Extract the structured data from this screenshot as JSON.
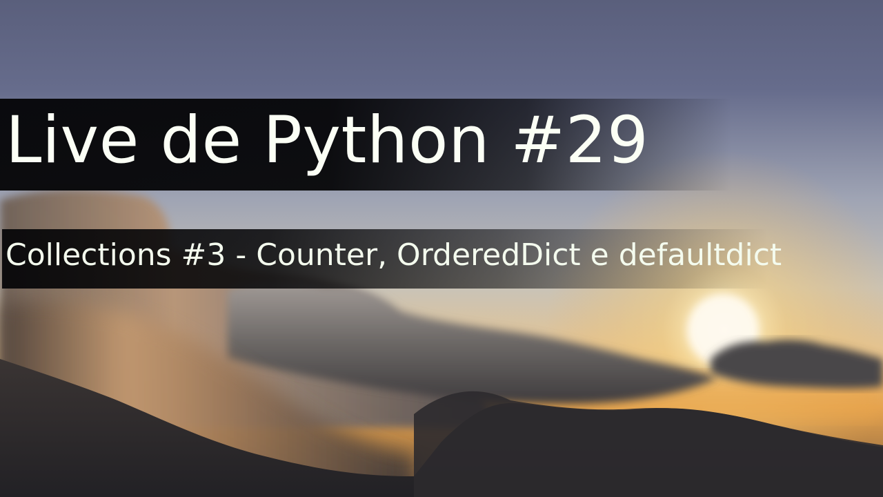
{
  "thumbnail": {
    "title": "Live de Python #29",
    "subtitle": "Collections #3 - Counter, OrderedDict e defaultdict"
  },
  "background": {
    "scene": "sunset-sky-clouds-mountains",
    "colors": {
      "sky_top": "#5c6282",
      "sky_mid": "#a9adb5",
      "horizon_glow": "#f2c46a",
      "sun": "#fff6d6",
      "cloud_lit": "#d8a676",
      "mountain_dark": "#2b2a2e"
    }
  }
}
